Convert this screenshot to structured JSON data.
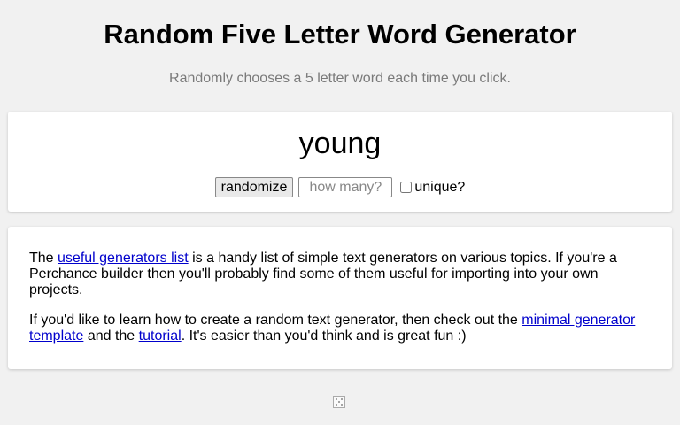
{
  "header": {
    "title": "Random Five Letter Word Generator",
    "subtitle": "Randomly chooses a 5 letter word each time you click."
  },
  "output": {
    "word": "young"
  },
  "controls": {
    "randomize_label": "randomize",
    "count_placeholder": "how many?",
    "count_value": "",
    "unique_label": "unique?",
    "unique_checked": false
  },
  "info": {
    "p1_pre": "The ",
    "p1_link": "useful generators list",
    "p1_post": " is a handy list of simple text generators on various topics. If you're a Perchance builder then you'll probably find some of them useful for importing into your own projects.",
    "p2_pre": "If you'd like to learn how to create a random text generator, then check out the ",
    "p2_link1": "minimal generator template",
    "p2_mid": " and the ",
    "p2_link2": "tutorial",
    "p2_post": ". It's easier than you'd think and is great fun :)"
  },
  "footer": {
    "icon": "dice-icon"
  },
  "colors": {
    "background": "#f1f1f1",
    "card": "#ffffff",
    "link": "#0000cc",
    "subtitle": "#7a7a7a"
  }
}
